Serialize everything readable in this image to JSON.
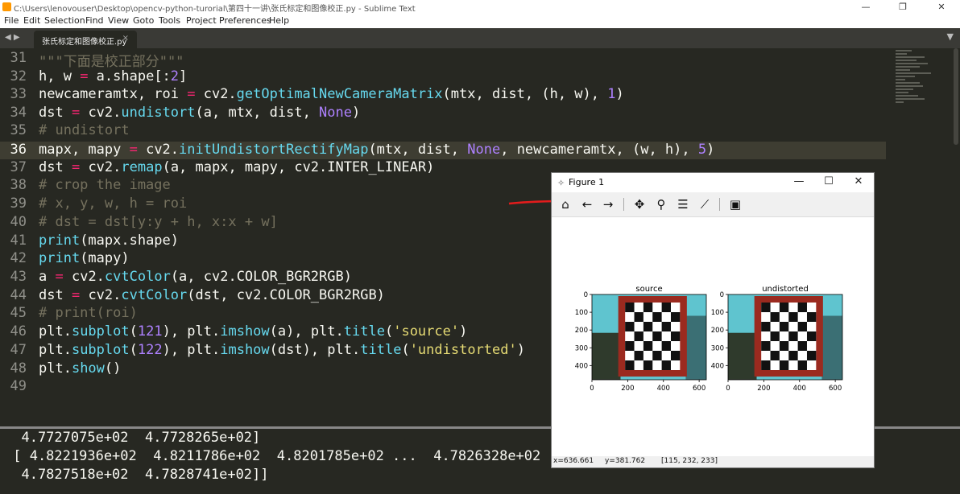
{
  "window": {
    "title": "C:\\Users\\lenovouser\\Desktop\\opencv-python-turorial\\第四十一讲\\张氏标定和图像校正.py - Sublime Text",
    "minimize_glyph": "—",
    "maximize_glyph": "❐",
    "close_glyph": "✕"
  },
  "menu": [
    "File",
    "Edit",
    "Selection",
    "Find",
    "View",
    "Goto",
    "Tools",
    "Project",
    "Preferences",
    "Help"
  ],
  "tab": {
    "label": "张氏标定和图像校正.py",
    "close_glyph": "×",
    "nav_glyph": "◀ ▶",
    "dropdown_glyph": "▼"
  },
  "editor": {
    "current_line": 36,
    "lines": [
      {
        "n": "31",
        "t": "\"\"\"下面是校正部分\"\"\""
      },
      {
        "n": "32",
        "t": "h, w = a.shape[:2]"
      },
      {
        "n": "33",
        "t": "newcameramtx, roi = cv2.getOptimalNewCameraMatrix(mtx, dist, (h, w), 1)"
      },
      {
        "n": "34",
        "t": "dst = cv2.undistort(a, mtx, dist, None)"
      },
      {
        "n": "35",
        "t": "# undistort"
      },
      {
        "n": "36",
        "t": "mapx, mapy = cv2.initUndistortRectifyMap(mtx, dist, None, newcameramtx, (w, h), 5)"
      },
      {
        "n": "37",
        "t": "dst = cv2.remap(a, mapx, mapy, cv2.INTER_LINEAR)"
      },
      {
        "n": "38",
        "t": "# crop the image"
      },
      {
        "n": "39",
        "t": "# x, y, w, h = roi"
      },
      {
        "n": "40",
        "t": "# dst = dst[y:y + h, x:x + w]"
      },
      {
        "n": "41",
        "t": "print(mapx.shape)"
      },
      {
        "n": "42",
        "t": "print(mapy)"
      },
      {
        "n": "43",
        "t": "a = cv2.cvtColor(a, cv2.COLOR_BGR2RGB)"
      },
      {
        "n": "44",
        "t": "dst = cv2.cvtColor(dst, cv2.COLOR_BGR2RGB)"
      },
      {
        "n": "45",
        "t": "# print(roi)"
      },
      {
        "n": "46",
        "t": "plt.subplot(121), plt.imshow(a), plt.title('source')"
      },
      {
        "n": "47",
        "t": "plt.subplot(122), plt.imshow(dst), plt.title('undistorted')"
      },
      {
        "n": "48",
        "t": "plt.show()"
      },
      {
        "n": "49",
        "t": ""
      }
    ]
  },
  "console": [
    "  4.7727075e+02  4.7728265e+02]",
    " [ 4.8221936e+02  4.8211786e+02  4.8201785e+02 ...  4.7826328e+02",
    "  4.7827518e+02  4.7828741e+02]]"
  ],
  "figure": {
    "title": "Figure 1",
    "app_icon": "✧",
    "min_glyph": "—",
    "max_glyph": "☐",
    "close_glyph": "✕",
    "toolbar": [
      {
        "name": "home-icon",
        "glyph": "⌂"
      },
      {
        "name": "back-arrow-icon",
        "glyph": "←"
      },
      {
        "name": "forward-arrow-icon",
        "glyph": "→"
      },
      {
        "name": "pan-icon",
        "glyph": "✥"
      },
      {
        "name": "zoom-icon",
        "glyph": "⚲"
      },
      {
        "name": "subplots-config-icon",
        "glyph": "☰"
      },
      {
        "name": "edit-axes-icon",
        "glyph": "⟋"
      },
      {
        "name": "save-icon",
        "glyph": "▣"
      }
    ],
    "status": {
      "x": "x=636.661",
      "y": "y=381.762",
      "rgb": "[115, 232, 233]"
    },
    "colors": {
      "board_frame": "#9b2a1f",
      "scene_cyan": "#5fc4cf",
      "scene_dark": "#2f3a2c"
    }
  },
  "chart_data": [
    {
      "type": "image",
      "title": "source",
      "xticks": [
        "0",
        "200",
        "400",
        "600"
      ],
      "yticks": [
        "0",
        "100",
        "200",
        "300",
        "400"
      ],
      "xlim": [
        0,
        640
      ],
      "ylim": [
        480,
        0
      ],
      "checkerboard": {
        "rows": 7,
        "cols": 6
      }
    },
    {
      "type": "image",
      "title": "undistorted",
      "xticks": [
        "0",
        "200",
        "400",
        "600"
      ],
      "yticks": [
        "0",
        "100",
        "200",
        "300",
        "400"
      ],
      "xlim": [
        0,
        640
      ],
      "ylim": [
        480,
        0
      ],
      "checkerboard": {
        "rows": 7,
        "cols": 6
      }
    }
  ]
}
